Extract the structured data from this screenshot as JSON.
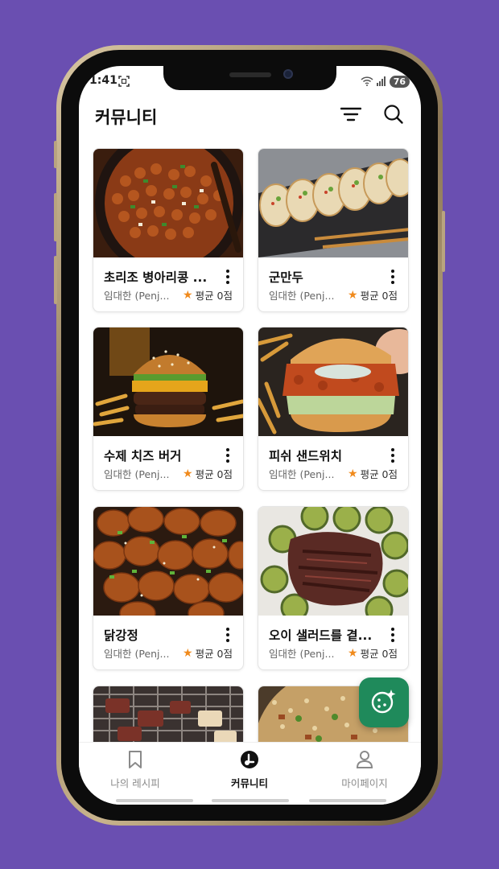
{
  "status_bar": {
    "time": "1:41",
    "battery": "76"
  },
  "header": {
    "title": "커뮤니티",
    "filter_icon": "filter-icon",
    "search_icon": "search-icon"
  },
  "feed": {
    "cards": [
      {
        "title": "초리조 병아리콩 ...",
        "author": "임대한 (Penj...",
        "rating": "평균 0점",
        "image": "chickpea-stew"
      },
      {
        "title": "군만두",
        "author": "임대한 (Penj...",
        "rating": "평균 0점",
        "image": "dumplings"
      },
      {
        "title": "수제 치즈 버거",
        "author": "임대한 (Penj...",
        "rating": "평균 0점",
        "image": "cheeseburger"
      },
      {
        "title": "피쉬 샌드위치",
        "author": "임대한 (Penj...",
        "rating": "평균 0점",
        "image": "fish-sandwich"
      },
      {
        "title": "닭강정",
        "author": "임대한 (Penj...",
        "rating": "평균 0점",
        "image": "fried-chicken"
      },
      {
        "title": "오이 샐러드를 곁...",
        "author": "임대한 (Penj...",
        "rating": "평균 0점",
        "image": "steak-cucumber"
      },
      {
        "title": "",
        "author": "",
        "rating": "",
        "image": "grilled-meat"
      },
      {
        "title": "",
        "author": "",
        "rating": "",
        "image": "fried-rice"
      }
    ]
  },
  "fab": {
    "icon": "ai-cookie-sparkle-icon"
  },
  "bottom_nav": {
    "items": [
      {
        "label": "나의 레시피",
        "icon": "bookmark-icon",
        "active": false
      },
      {
        "label": "커뮤니티",
        "icon": "community-icon",
        "active": true
      },
      {
        "label": "마이페이지",
        "icon": "person-icon",
        "active": false
      }
    ]
  },
  "colors": {
    "background": "#6a4fb1",
    "fab": "#1f8a5b",
    "star": "#f08a1c"
  }
}
